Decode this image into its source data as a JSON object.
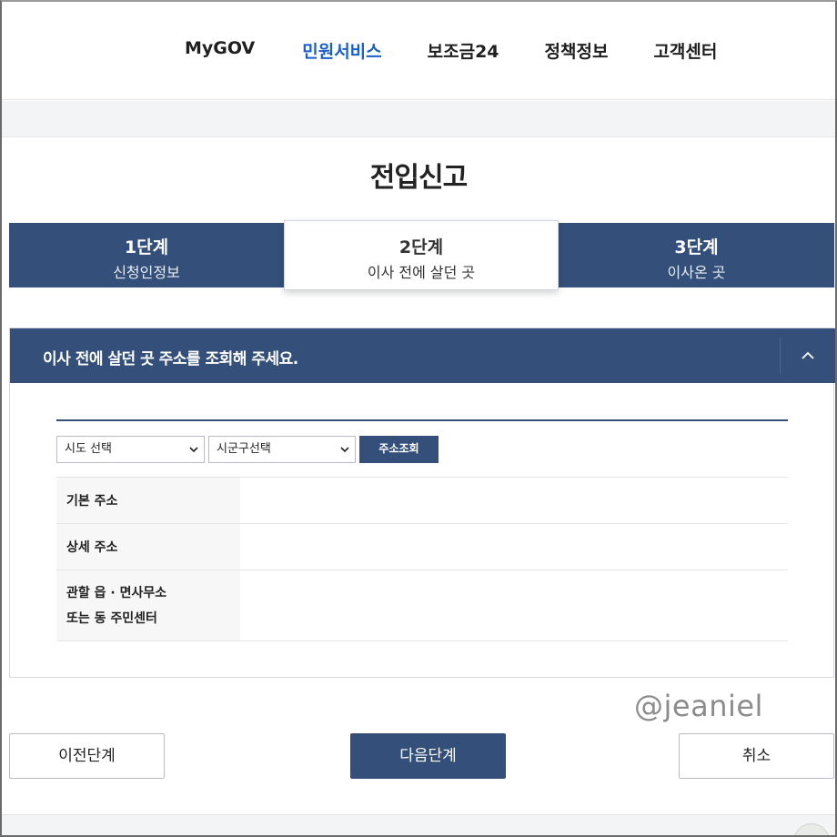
{
  "nav": {
    "items": [
      "MyGOV",
      "민원서비스",
      "보조금24",
      "정책정보",
      "고객센터"
    ],
    "active_index": 1
  },
  "page": {
    "title": "전입신고"
  },
  "steps": [
    {
      "num": "1단계",
      "name": "신청인정보"
    },
    {
      "num": "2단계",
      "name": "이사 전에 살던 곳"
    },
    {
      "num": "3단계",
      "name": "이사온 곳"
    }
  ],
  "current_step": 2,
  "panel": {
    "title": "이사 전에 살던 곳 주소를 조회해 주세요.",
    "toggle_icon": "chevron-up-icon",
    "sido_select": "시도 선택",
    "sigungu_select": "시군구선택",
    "search_button": "주소조회",
    "rows": {
      "basic": "기본 주소",
      "detail": "상세 주소",
      "office_line1": "관할 읍 · 면사무소",
      "office_line2": "또는 동 주민센터"
    }
  },
  "watermark": "@jeaniel",
  "buttons": {
    "prev": "이전단계",
    "next": "다음단계",
    "cancel": "취소"
  },
  "colors": {
    "primary": "#34507a",
    "nav_active": "#1a5fc8"
  }
}
